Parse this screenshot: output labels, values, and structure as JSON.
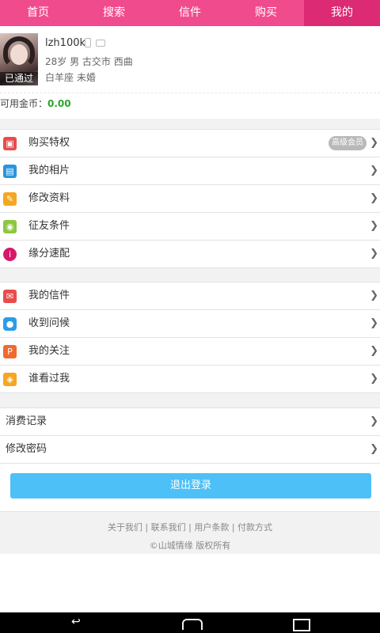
{
  "tabs": [
    {
      "label": "首页"
    },
    {
      "label": "搜索"
    },
    {
      "label": "信件"
    },
    {
      "label": "购买"
    },
    {
      "label": "我的"
    }
  ],
  "profile": {
    "username": "lzh100k",
    "line2": "28岁 男 古交市 西曲",
    "line3": "白羊座 未婚",
    "avatar_badge": "已通过"
  },
  "coins": {
    "label": "可用金币：",
    "value": "0.00"
  },
  "group1": [
    {
      "label": "购买特权",
      "icon": "gift-icon",
      "tag": "高级会员",
      "color": "#e84c4c"
    },
    {
      "label": "我的相片",
      "icon": "photo-icon",
      "color": "#2a95dc"
    },
    {
      "label": "修改资料",
      "icon": "edit-icon",
      "color": "#f5a623"
    },
    {
      "label": "征友条件",
      "icon": "chat-icon",
      "color": "#8ec63f"
    },
    {
      "label": "缘分速配",
      "icon": "info-icon",
      "color": "#d6196a"
    }
  ],
  "group2": [
    {
      "label": "我的信件",
      "icon": "mail-icon",
      "color": "#e84c4c"
    },
    {
      "label": "收到问候",
      "icon": "bubble-icon",
      "color": "#2a9de8"
    },
    {
      "label": "我的关注",
      "icon": "follow-icon",
      "color": "#ef6a2c"
    },
    {
      "label": "谁看过我",
      "icon": "visitor-icon",
      "color": "#f5a623"
    }
  ],
  "group3": [
    {
      "label": "消费记录"
    },
    {
      "label": "修改密码"
    }
  ],
  "logout_label": "退出登录",
  "footer": {
    "links": [
      "关于我们",
      "联系我们",
      "用户条款",
      "付款方式"
    ],
    "copyright": "©山城情缘 版权所有"
  },
  "colors": {
    "brand": "#f04c8d",
    "brand_active": "#dc2a74",
    "logout": "#4dc0f7",
    "coin": "#2aa52a"
  }
}
